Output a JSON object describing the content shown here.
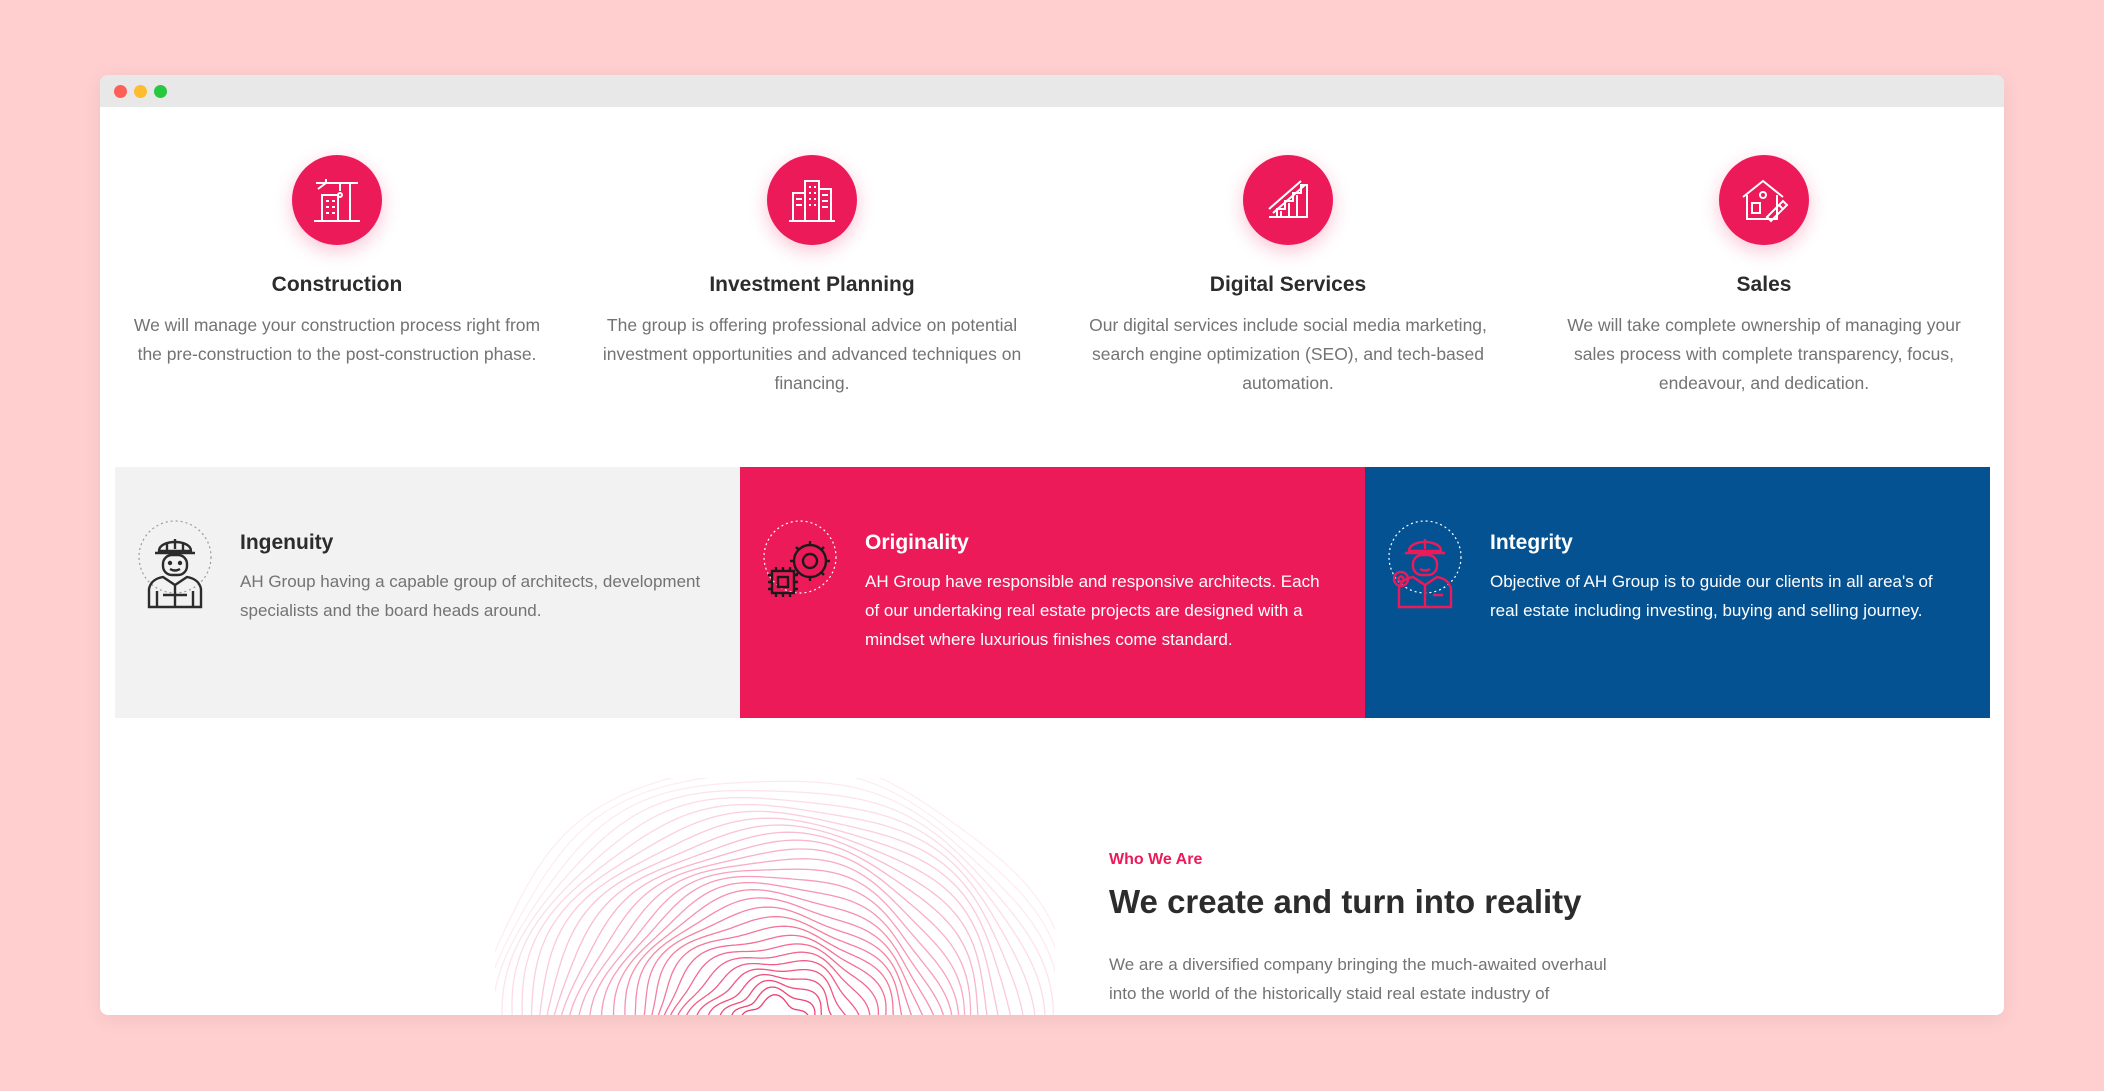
{
  "services": [
    {
      "icon": "construction-crane-icon",
      "title": "Construction",
      "desc": "We will manage your construction process right from the pre-construction to the post-construction phase."
    },
    {
      "icon": "buildings-icon",
      "title": "Investment Planning",
      "desc": "The group is offering professional advice on potential investment opportunities and advanced techniques on financing."
    },
    {
      "icon": "stairs-icon",
      "title": "Digital Services",
      "desc": "Our digital services include social media marketing, search engine optimization (SEO), and tech-based automation."
    },
    {
      "icon": "house-plan-icon",
      "title": "Sales",
      "desc": "We will take complete ownership of managing your sales process with complete transparency, focus, endeavour, and dedication."
    }
  ],
  "values": [
    {
      "icon": "worker-icon",
      "title": "Ingenuity",
      "desc": "AH Group having a capable group of architects, development specialists and the board heads around."
    },
    {
      "icon": "gear-chip-icon",
      "title": "Originality",
      "desc": "AH Group have responsible and responsive architects. Each of our undertaking real estate projects are designed with a mindset where luxurious finishes come standard."
    },
    {
      "icon": "engineer-icon",
      "title": "Integrity",
      "desc": "Objective of AH Group is to guide our clients in all area's of real estate including investing, buying and selling journey."
    }
  ],
  "about": {
    "kicker": "Who We Are",
    "headline": "We create and turn into reality",
    "paragraph": "We are a diversified company bringing the much-awaited overhaul into the world of the historically staid real estate industry of Pakistan. AH Group is offering real estate services, having registered offices in Islamabad, Peshawar, Hangu and Kohat. We’re a team of experts working together to build,"
  },
  "colors": {
    "accent": "#ed1a5a",
    "navy": "#045292",
    "grey_panel": "#f2f2f2",
    "page_bg": "#ffcece"
  }
}
